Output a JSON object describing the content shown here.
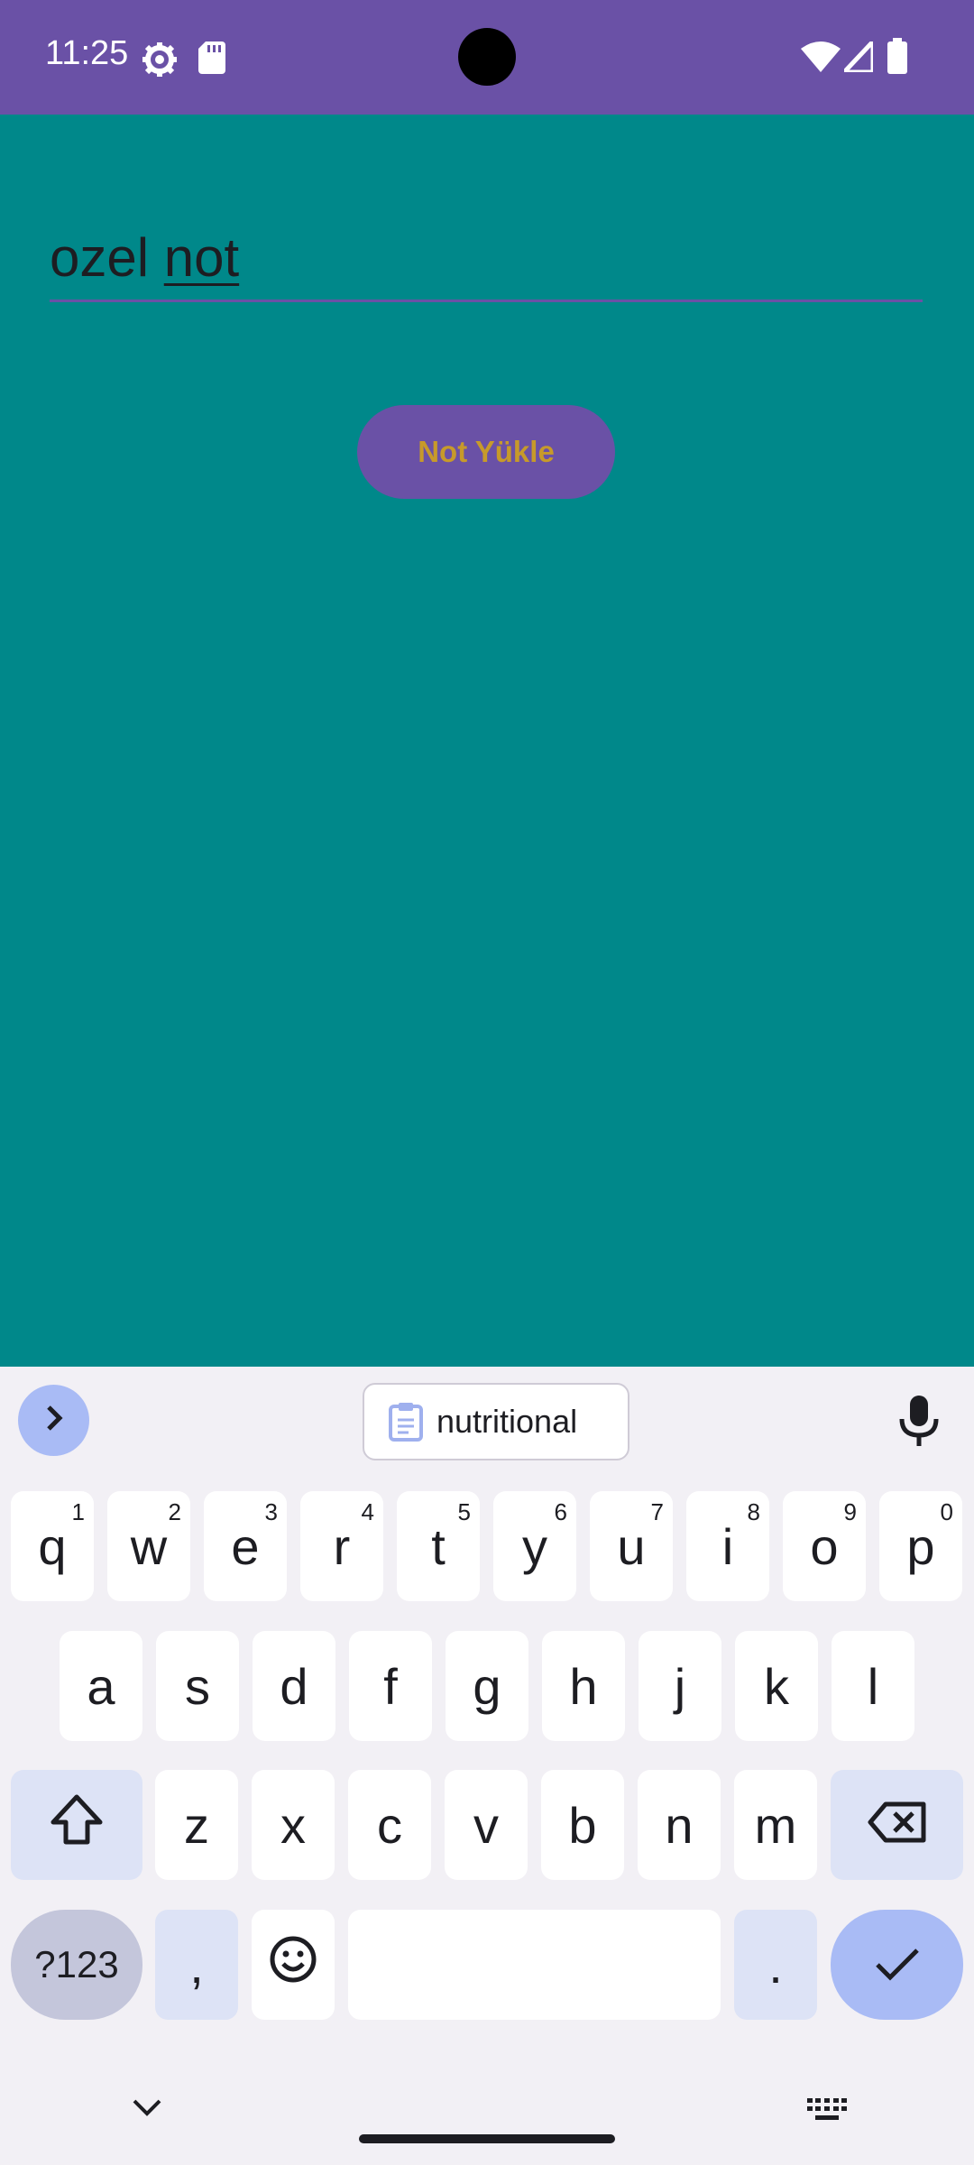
{
  "status_bar": {
    "time": "11:25",
    "icons": [
      "settings-gear-icon",
      "sd-card-icon",
      "wifi-icon",
      "signal-icon",
      "battery-icon"
    ]
  },
  "note_input": {
    "text_plain": "ozel ",
    "text_underlined": "not"
  },
  "load_button": {
    "label": "Not Yükle"
  },
  "keyboard": {
    "suggestion": "nutritional",
    "rows": [
      [
        {
          "k": "q",
          "h": "1"
        },
        {
          "k": "w",
          "h": "2"
        },
        {
          "k": "e",
          "h": "3"
        },
        {
          "k": "r",
          "h": "4"
        },
        {
          "k": "t",
          "h": "5"
        },
        {
          "k": "y",
          "h": "6"
        },
        {
          "k": "u",
          "h": "7"
        },
        {
          "k": "i",
          "h": "8"
        },
        {
          "k": "o",
          "h": "9"
        },
        {
          "k": "p",
          "h": "0"
        }
      ],
      [
        {
          "k": "a"
        },
        {
          "k": "s"
        },
        {
          "k": "d"
        },
        {
          "k": "f"
        },
        {
          "k": "g"
        },
        {
          "k": "h"
        },
        {
          "k": "j"
        },
        {
          "k": "k"
        },
        {
          "k": "l"
        }
      ],
      [
        {
          "k": "z"
        },
        {
          "k": "x"
        },
        {
          "k": "c"
        },
        {
          "k": "v"
        },
        {
          "k": "b"
        },
        {
          "k": "n"
        },
        {
          "k": "m"
        }
      ]
    ],
    "symbols_label": "?123",
    "comma_label": ",",
    "period_label": "."
  },
  "colors": {
    "app_bar": "#6a51a6",
    "background": "#00888a",
    "button_text": "#c79a2a",
    "keyboard_bg": "#f2f0f5",
    "accent_blue": "#a9bbf5"
  }
}
